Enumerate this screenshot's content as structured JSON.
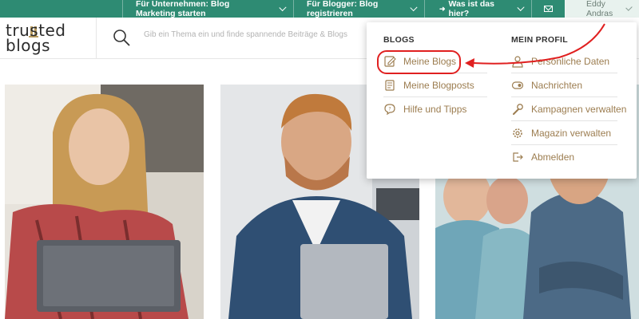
{
  "topbar": {
    "business_label": "Für Unternehmen: Blog Marketing starten",
    "blogger_label": "Für Blogger: Blog registrieren",
    "about_label": "Was ist das hier?",
    "user_name": "Eddy Andras"
  },
  "header": {
    "logo_line1": "trusted",
    "logo_line2": "blogs",
    "search_placeholder": "Gib ein Thema ein und finde spannende Beiträge & Blogs"
  },
  "dropdown": {
    "blogs_title": "BLOGS",
    "blogs_items": [
      {
        "label": "Meine Blogs",
        "icon": "edit-icon"
      },
      {
        "label": "Meine Blogposts",
        "icon": "document-icon"
      },
      {
        "label": "Hilfe und Tipps",
        "icon": "chat-bubble-icon"
      }
    ],
    "profile_title": "MEIN PROFIL",
    "profile_items": [
      {
        "label": "Persönliche Daten",
        "icon": "person-icon"
      },
      {
        "label": "Nachrichten",
        "icon": "message-icon"
      },
      {
        "label": "Kampagnen verwalten",
        "icon": "wrench-icon"
      },
      {
        "label": "Magazin verwalten",
        "icon": "gear-icon"
      },
      {
        "label": "Abmelden",
        "icon": "logout-icon"
      }
    ]
  },
  "colors": {
    "topbar_bg": "#2e8b73",
    "menu_text": "#9c7d50",
    "annotation": "#e02020"
  }
}
